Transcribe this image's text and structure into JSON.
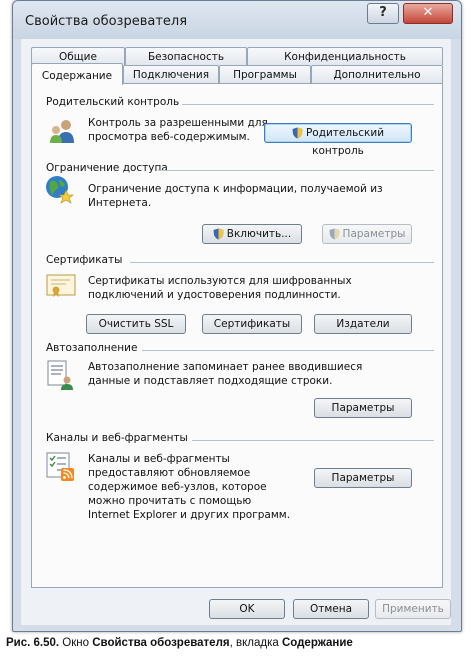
{
  "window": {
    "title": "Свойства обозревателя",
    "help_label": "?",
    "close_label": "✕"
  },
  "tabs": {
    "row1": [
      "Общие",
      "Безопасность",
      "Конфиденциальность"
    ],
    "row2": [
      "Содержание",
      "Подключения",
      "Программы",
      "Дополнительно"
    ],
    "active": "Содержание"
  },
  "sections": {
    "parental": {
      "title": "Родительский контроль",
      "text_1": "Контроль за разрешенными для",
      "text_2": "просмотра веб-содержимым.",
      "button": "Родительский контроль"
    },
    "restriction": {
      "title": "Ограничение доступа",
      "text_1": "Ограничение доступа к информации, получаемой из",
      "text_2": "Интернета.",
      "enable_button": "Включить...",
      "settings_button": "Параметры"
    },
    "certificates": {
      "title": "Сертификаты",
      "text_1": "Сертификаты используются для шифрованных",
      "text_2": "подключений и удостоверения подлинности.",
      "clear_ssl_button": "Очистить SSL",
      "certificates_button": "Сертификаты",
      "publishers_button": "Издатели"
    },
    "autocomplete": {
      "title": "Автозаполнение",
      "text_1": "Автозаполнение запоминает ранее вводившиеся",
      "text_2": "данные и подставляет подходящие строки.",
      "settings_button": "Параметры"
    },
    "feeds": {
      "title": "Каналы и веб-фрагменты",
      "text_1": "Каналы и веб-фрагменты",
      "text_2": "предоставляют обновляемое",
      "text_3": "содержимое веб-узлов, которое",
      "text_4": "можно прочитать с помощью",
      "text_5": "Internet Explorer и других программ.",
      "settings_button": "Параметры"
    }
  },
  "footer": {
    "ok": "OK",
    "cancel": "Отмена",
    "apply": "Применить"
  },
  "caption": {
    "prefix": "Рис. 6.50.",
    "text_1": " Окно ",
    "bold_1": "Свойства обозревателя",
    "text_2": ", вкладка ",
    "bold_2": "Содержание"
  }
}
